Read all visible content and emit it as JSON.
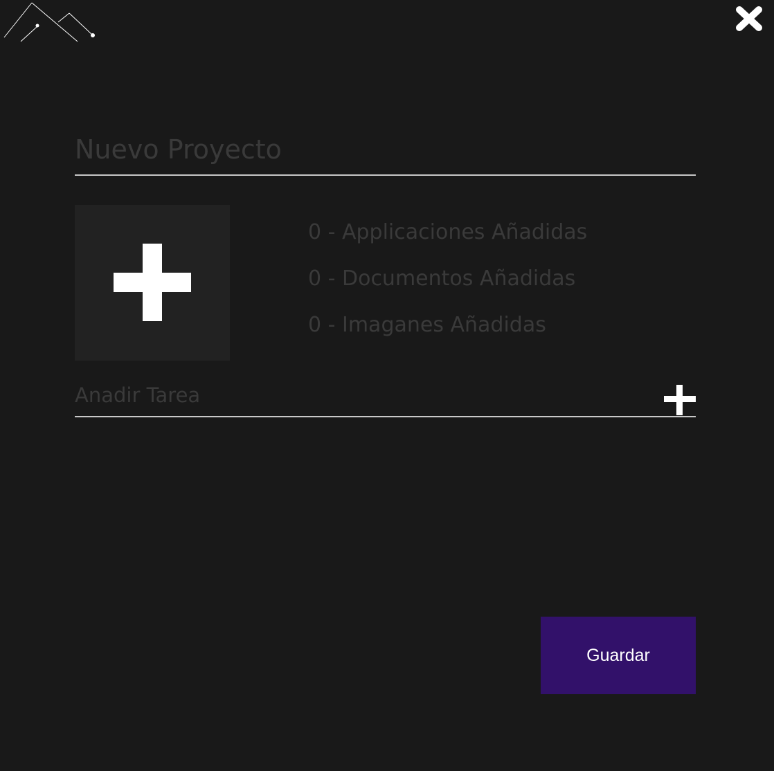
{
  "colors": {
    "background": "#191919",
    "tile_background": "#222222",
    "muted_text": "#3a3a3a",
    "underline": "#c8c8c8",
    "primary_button": "#32116a",
    "icon": "#ffffff"
  },
  "header": {
    "logo_icon": "mountain-logo-icon",
    "close_icon": "close-icon"
  },
  "project": {
    "name_value": "",
    "name_placeholder": "Nuevo Proyecto"
  },
  "media": {
    "add_icon": "plus-icon",
    "counts": [
      {
        "text": "0 - Applicaciones Añadidas"
      },
      {
        "text": "0 - Documentos Añadidas"
      },
      {
        "text": "0 - Imaganes Añadidas"
      }
    ]
  },
  "task": {
    "value": "",
    "placeholder": "Anadir Tarea",
    "add_icon": "plus-icon"
  },
  "actions": {
    "save_label": "Guardar"
  }
}
